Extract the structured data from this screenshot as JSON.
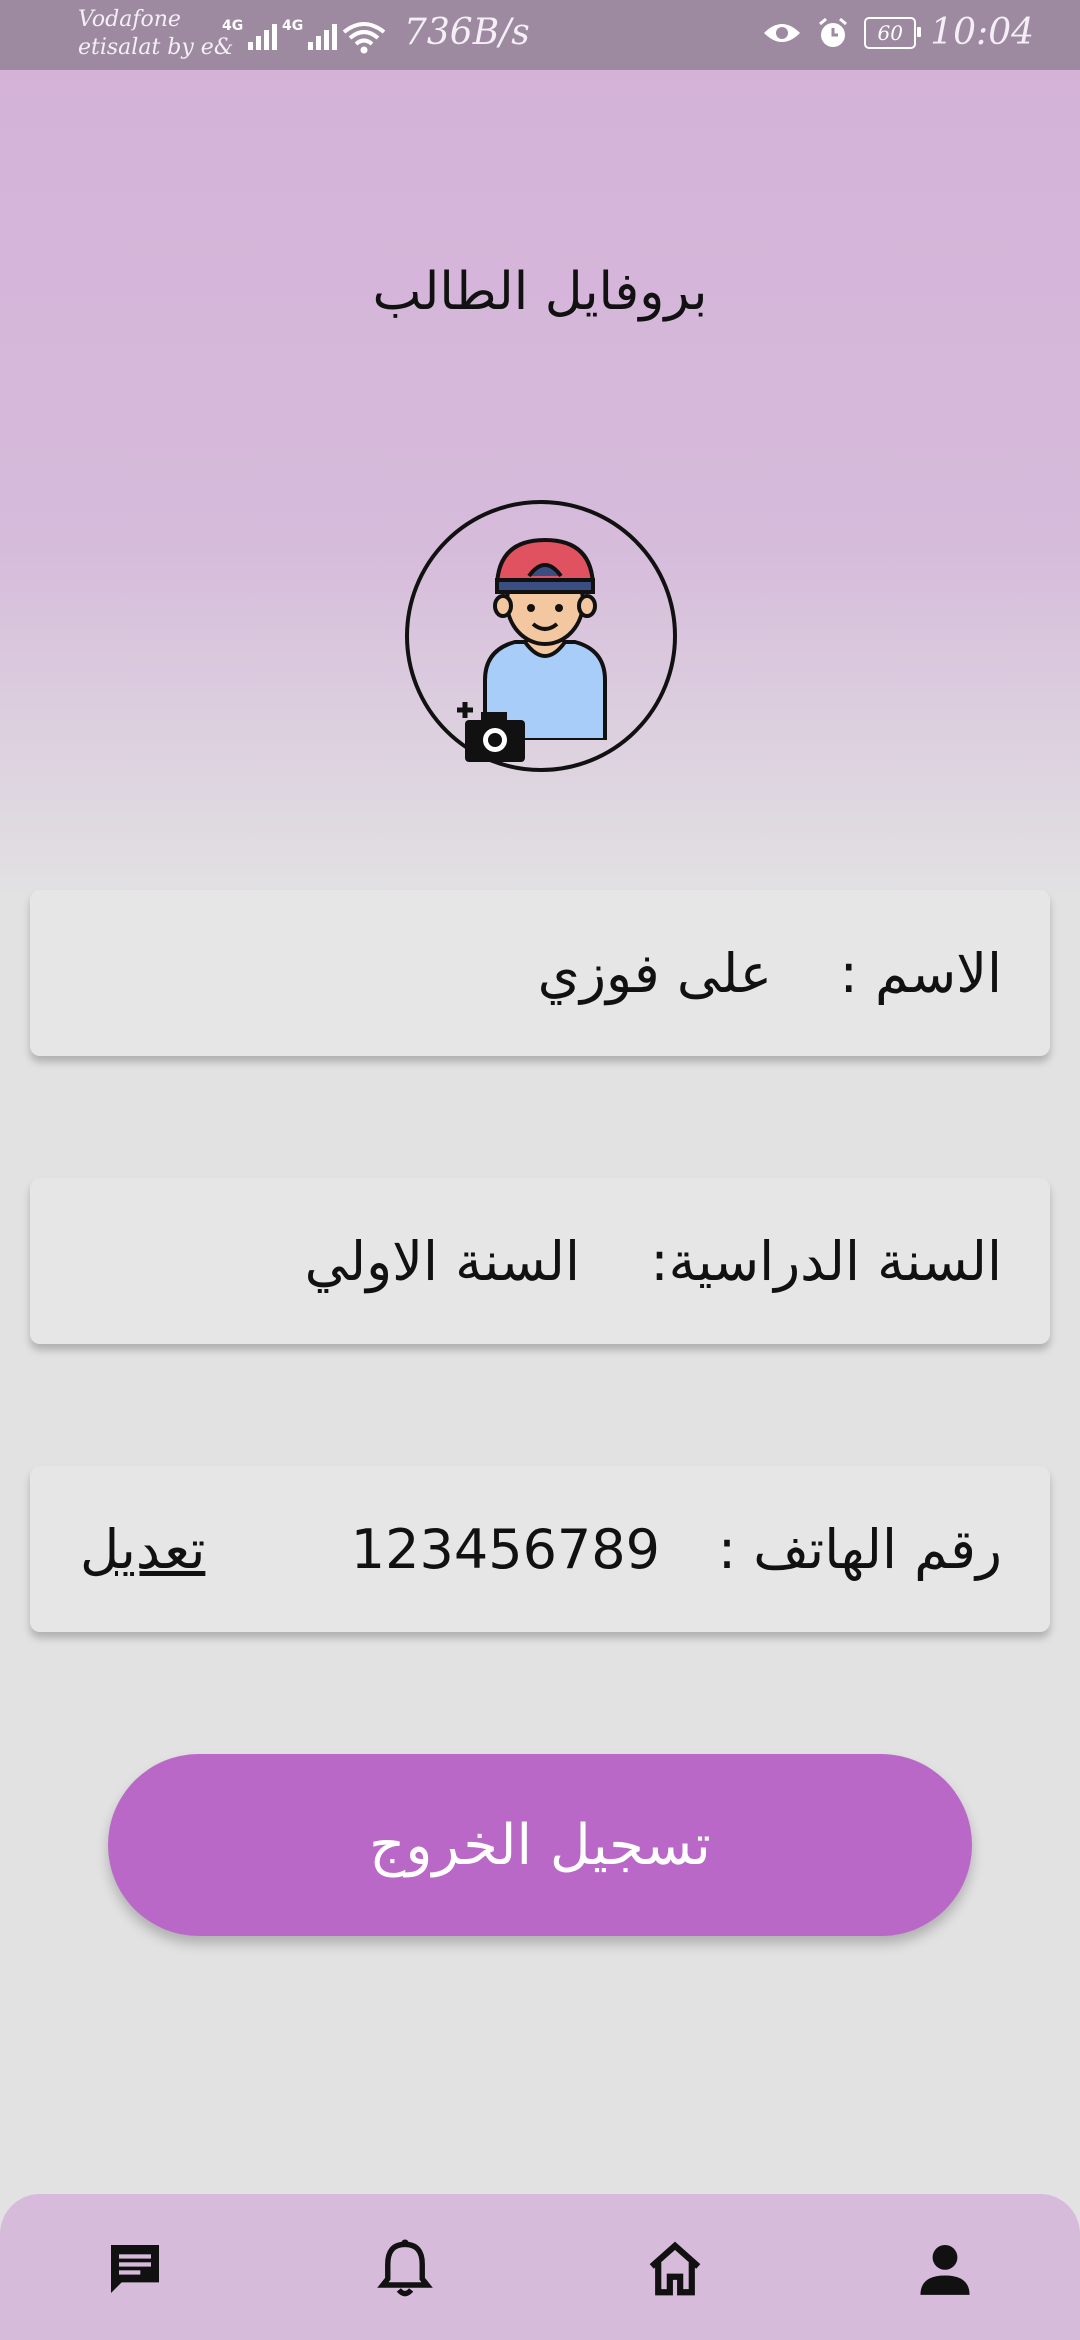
{
  "status_bar": {
    "carrier_line1": "Vodafone",
    "carrier_line2": "etisalat by e&",
    "network1": "4G",
    "network2": "4G",
    "speed": "736B/s",
    "battery": "60",
    "time": "10:04"
  },
  "header": {
    "title": "بروفايل الطالب"
  },
  "profile": {
    "name_label": "الاسم  :",
    "name_value": "على فوزي",
    "year_label": "السنة الدراسية:",
    "year_value": "السنة الاولي",
    "phone_label": "رقم الهاتف :",
    "phone_value": "123456789",
    "edit_label": "تعديل"
  },
  "logout_label": "تسجيل الخروج",
  "bottom_nav": [
    {
      "icon": "chat-icon"
    },
    {
      "icon": "bell-icon"
    },
    {
      "icon": "home-icon"
    },
    {
      "icon": "person-icon"
    }
  ],
  "colors": {
    "accent": "#b968c8",
    "header_bg": "#d4b1d8",
    "nav_bg": "#d6bbdb",
    "card_bg": "#e6e6e6"
  }
}
